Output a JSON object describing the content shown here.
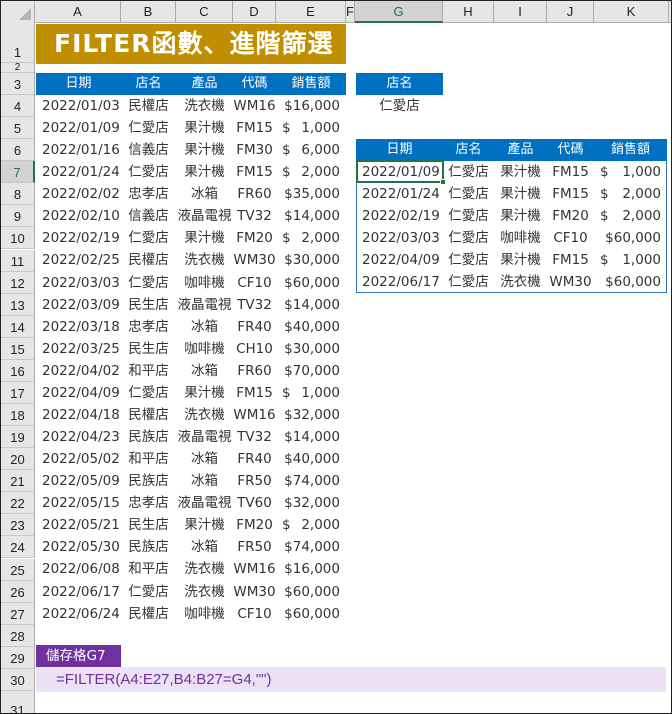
{
  "sheet": {
    "columns": [
      "A",
      "B",
      "C",
      "D",
      "E",
      "F",
      "G",
      "H",
      "I",
      "J",
      "K"
    ],
    "selected_column": "G",
    "selected_row": 7,
    "rows": [
      1,
      2,
      3,
      4,
      5,
      6,
      7,
      8,
      9,
      10,
      11,
      12,
      13,
      14,
      15,
      16,
      17,
      18,
      19,
      20,
      21,
      22,
      23,
      24,
      25,
      26,
      27,
      28,
      29,
      30,
      31
    ]
  },
  "title": "FILTER函數、進階篩選",
  "source_table": {
    "headers": [
      "日期",
      "店名",
      "產品",
      "代碼",
      "銷售額"
    ],
    "rows": [
      [
        "2022/01/03",
        "民權店",
        "洗衣機",
        "WM16",
        "$16,000"
      ],
      [
        "2022/01/09",
        "仁愛店",
        "果汁機",
        "FM15",
        "$ 1,000"
      ],
      [
        "2022/01/16",
        "信義店",
        "果汁機",
        "FM30",
        "$ 6,000"
      ],
      [
        "2022/01/24",
        "仁愛店",
        "果汁機",
        "FM15",
        "$ 2,000"
      ],
      [
        "2022/02/02",
        "忠孝店",
        "冰箱",
        "FR60",
        "$35,000"
      ],
      [
        "2022/02/10",
        "信義店",
        "液晶電視",
        "TV32",
        "$14,000"
      ],
      [
        "2022/02/19",
        "仁愛店",
        "果汁機",
        "FM20",
        "$ 2,000"
      ],
      [
        "2022/02/25",
        "民權店",
        "洗衣機",
        "WM30",
        "$30,000"
      ],
      [
        "2022/03/03",
        "仁愛店",
        "咖啡機",
        "CF10",
        "$60,000"
      ],
      [
        "2022/03/09",
        "民生店",
        "液晶電視",
        "TV32",
        "$14,000"
      ],
      [
        "2022/03/18",
        "忠孝店",
        "冰箱",
        "FR40",
        "$40,000"
      ],
      [
        "2022/03/25",
        "民生店",
        "咖啡機",
        "CH10",
        "$30,000"
      ],
      [
        "2022/04/02",
        "和平店",
        "冰箱",
        "FR60",
        "$70,000"
      ],
      [
        "2022/04/09",
        "仁愛店",
        "果汁機",
        "FM15",
        "$ 1,000"
      ],
      [
        "2022/04/18",
        "民權店",
        "洗衣機",
        "WM16",
        "$32,000"
      ],
      [
        "2022/04/23",
        "民族店",
        "液晶電視",
        "TV32",
        "$14,000"
      ],
      [
        "2022/05/02",
        "和平店",
        "冰箱",
        "FR40",
        "$40,000"
      ],
      [
        "2022/05/09",
        "民族店",
        "冰箱",
        "FR50",
        "$74,000"
      ],
      [
        "2022/05/15",
        "忠孝店",
        "液晶電視",
        "TV60",
        "$32,000"
      ],
      [
        "2022/05/21",
        "民生店",
        "果汁機",
        "FM20",
        "$ 2,000"
      ],
      [
        "2022/05/30",
        "民族店",
        "冰箱",
        "FR50",
        "$74,000"
      ],
      [
        "2022/06/08",
        "和平店",
        "洗衣機",
        "WM16",
        "$16,000"
      ],
      [
        "2022/06/17",
        "仁愛店",
        "洗衣機",
        "WM30",
        "$60,000"
      ],
      [
        "2022/06/24",
        "民權店",
        "咖啡機",
        "CF10",
        "$60,000"
      ]
    ]
  },
  "criteria": {
    "header": "店名",
    "value": "仁愛店"
  },
  "result_table": {
    "headers": [
      "日期",
      "店名",
      "產品",
      "代碼",
      "銷售額"
    ],
    "rows": [
      [
        "2022/01/09",
        "仁愛店",
        "果汁機",
        "FM15",
        "$ 1,000"
      ],
      [
        "2022/01/24",
        "仁愛店",
        "果汁機",
        "FM15",
        "$ 2,000"
      ],
      [
        "2022/02/19",
        "仁愛店",
        "果汁機",
        "FM20",
        "$ 2,000"
      ],
      [
        "2022/03/03",
        "仁愛店",
        "咖啡機",
        "CF10",
        "$60,000"
      ],
      [
        "2022/04/09",
        "仁愛店",
        "果汁機",
        "FM15",
        "$ 1,000"
      ],
      [
        "2022/06/17",
        "仁愛店",
        "洗衣機",
        "WM30",
        "$60,000"
      ]
    ]
  },
  "note": {
    "label": "儲存格G7",
    "formula": "=FILTER(A4:E27,B4:B27=G4,\"\")"
  },
  "colors": {
    "title_bg": "#bf8f00",
    "header_bg": "#0070c0",
    "badge_bg": "#7030a0",
    "formula_bg": "#ece1f5",
    "selection": "#217346"
  }
}
